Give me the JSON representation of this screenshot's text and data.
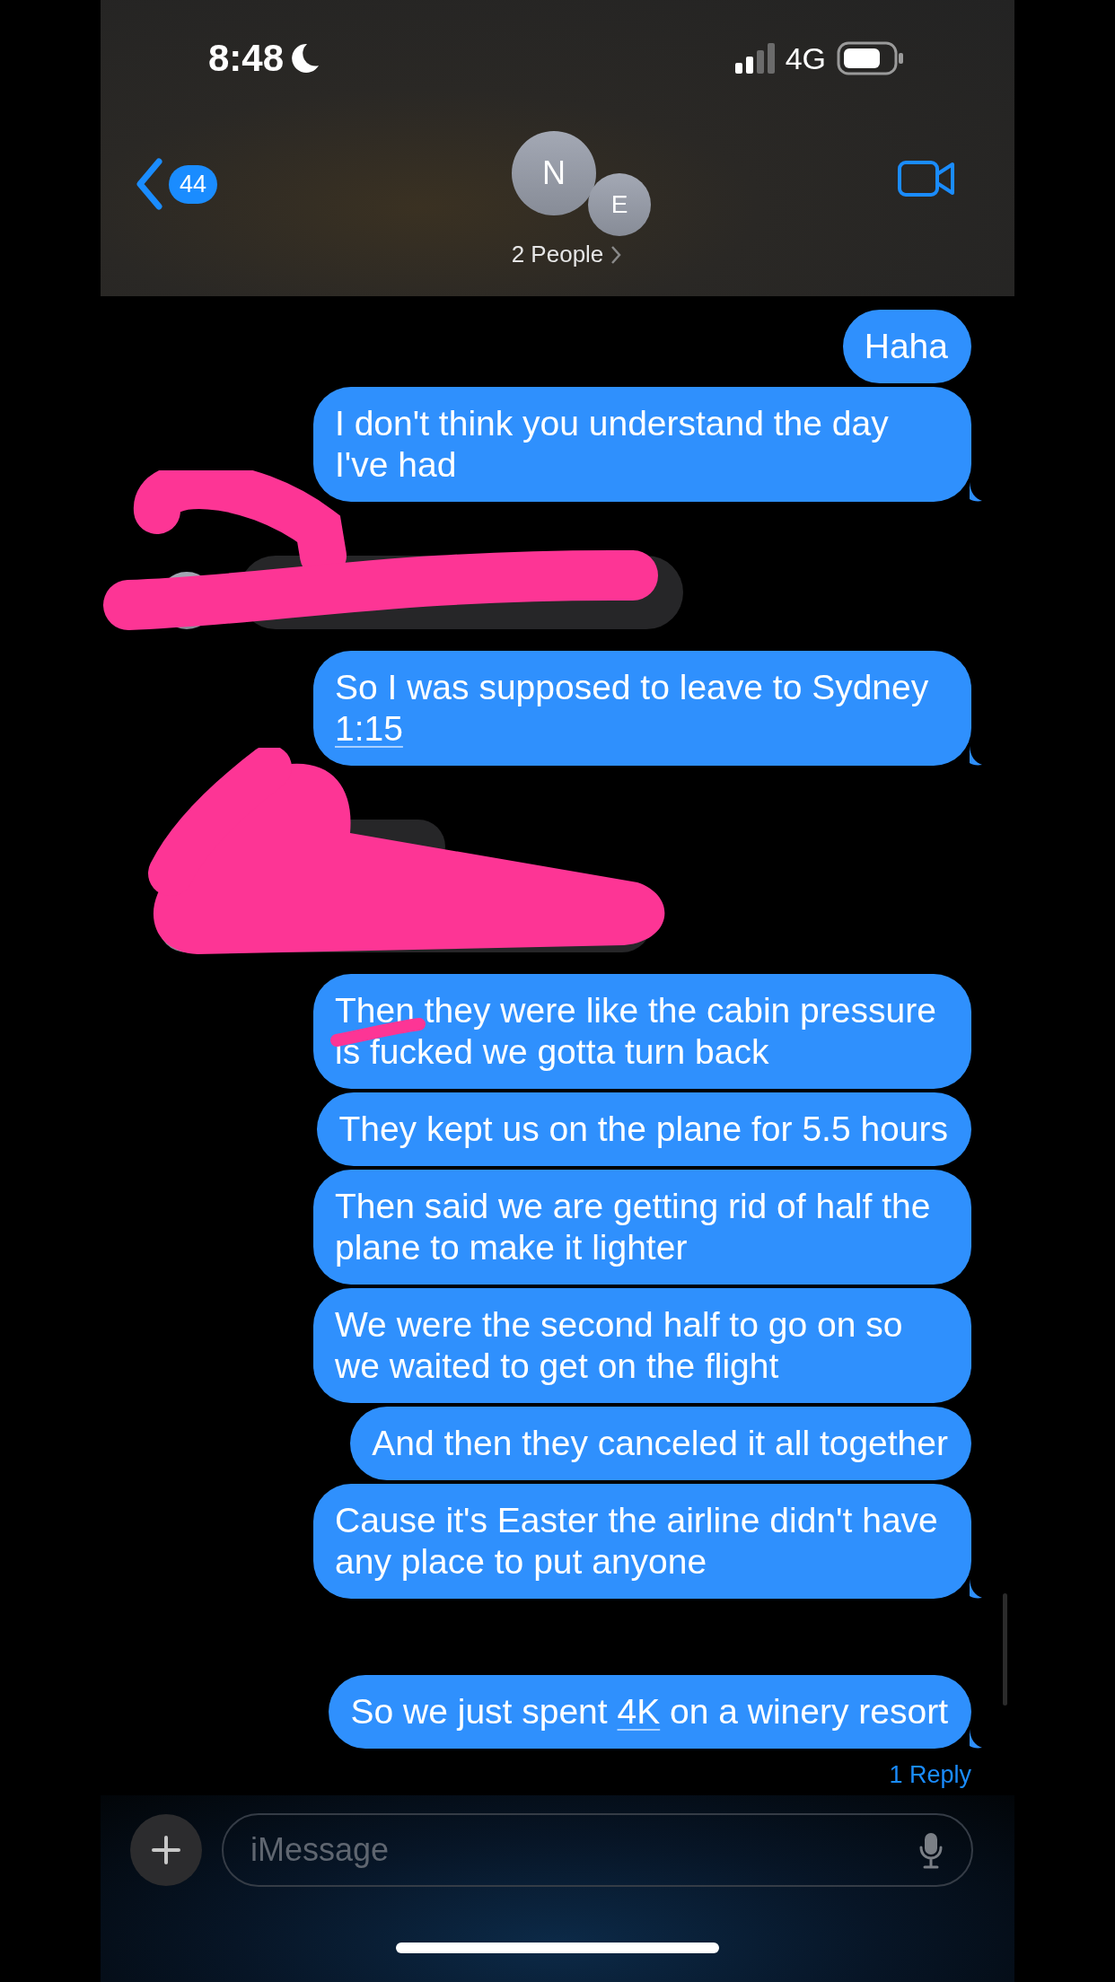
{
  "status_bar": {
    "time": "8:48",
    "network": "4G"
  },
  "header": {
    "back_count": "44",
    "avatars": [
      {
        "initial": "N"
      },
      {
        "initial": "E"
      }
    ],
    "title": "2 People"
  },
  "messages": [
    {
      "kind": "outgoing",
      "parts": [
        {
          "text": "Haha"
        }
      ],
      "tail": false
    },
    {
      "kind": "outgoing",
      "parts": [
        {
          "text": "I don't think you understand the day I've had"
        }
      ],
      "tail": true
    },
    {
      "kind": "incoming",
      "bubbles": [
        {
          "kind": "redacted"
        }
      ]
    },
    {
      "kind": "outgoing",
      "parts": [
        {
          "text": "So I was supposed to leave to Sydney "
        },
        {
          "text": "1:15",
          "link": true
        }
      ],
      "tail": true
    },
    {
      "kind": "incoming",
      "bubbles": [
        {
          "kind": "redacted"
        },
        {
          "kind": "redacted"
        }
      ]
    },
    {
      "kind": "outgoing",
      "parts": [
        {
          "text": "Then they were like the cabin pressure is fucked we gotta turn back"
        }
      ],
      "tail": false,
      "scribbled": true
    },
    {
      "kind": "outgoing",
      "parts": [
        {
          "text": "They kept us on the plane for 5.5 hours"
        }
      ],
      "tail": false
    },
    {
      "kind": "outgoing",
      "parts": [
        {
          "text": "Then said we are getting rid of half the plane to make it lighter"
        }
      ],
      "tail": false
    },
    {
      "kind": "outgoing",
      "parts": [
        {
          "text": "We were the second half to go on so we waited to get on the flight"
        }
      ],
      "tail": false
    },
    {
      "kind": "outgoing",
      "parts": [
        {
          "text": "And then they canceled it all together"
        }
      ],
      "tail": false
    },
    {
      "kind": "outgoing",
      "parts": [
        {
          "text": "Cause it's Easter the airline didn't have any place to put anyone"
        }
      ],
      "tail": true
    },
    {
      "kind": "outgoing",
      "parts": [
        {
          "text": "So we just spent "
        },
        {
          "text": "4K",
          "link": true
        },
        {
          "text": " on a winery resort"
        }
      ],
      "tail": true,
      "reply_count": "1 Reply"
    }
  ],
  "composer": {
    "placeholder": "iMessage"
  }
}
